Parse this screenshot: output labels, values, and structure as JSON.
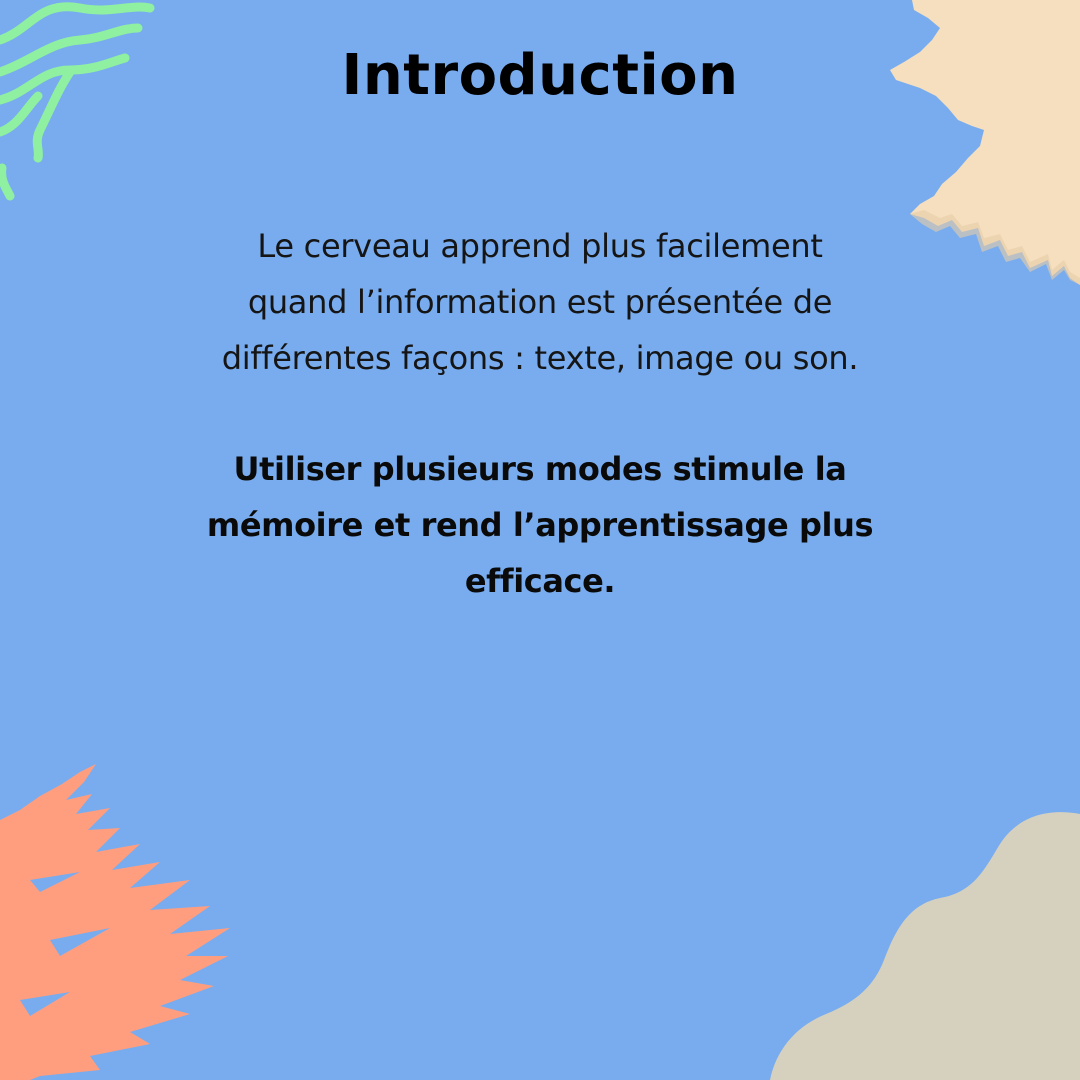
{
  "slide": {
    "title": "Introduction",
    "body_lines": [
      "Le cerveau apprend plus facilement",
      "quand l’information est présentée de",
      "différentes façons : texte, image ou son."
    ],
    "emphasis_lines": [
      "Utiliser plusieurs modes stimule la",
      "mémoire et rend l’apprentissage plus",
      "efficace."
    ]
  },
  "colors": {
    "background": "#78acee",
    "green_stroke": "#8ef0a0",
    "cream_brush": "#f5dfbf",
    "salmon_brush": "#ff9e7f",
    "beige_blob": "#d6d0bf",
    "text": "#000000"
  },
  "decorations": [
    "green-wave-lines",
    "cream-brush-stroke",
    "salmon-brush-stroke",
    "beige-blob"
  ]
}
